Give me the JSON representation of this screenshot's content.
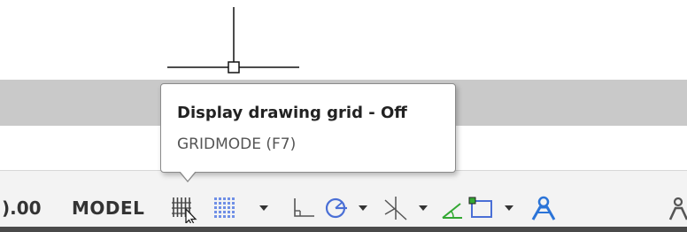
{
  "tooltip": {
    "title": "Display drawing grid - Off",
    "subtitle": "GRIDMODE (F7)"
  },
  "status_bar": {
    "coordinates": ").00",
    "model_label": "MODEL",
    "icons": [
      "grid-display-icon",
      "snap-mode-icon",
      "snap-dropdown-icon",
      "ortho-mode-icon",
      "polar-tracking-icon",
      "polar-dropdown-icon",
      "isodraft-icon",
      "isodraft-dropdown-icon",
      "object-snap-tracking-icon",
      "object-snap-icon",
      "object-snap-dropdown-icon",
      "annotation-visibility-icon",
      "annotation-scale-icon"
    ]
  },
  "colors": {
    "status_bar_bg": "#f3f3f3",
    "gray_band": "#c9c9c9",
    "snap_dots": "#6f8fe6",
    "polar_blue": "#4a6fd6",
    "ucs_green": "#33a833",
    "annotation_blue": "#2b74d8"
  }
}
